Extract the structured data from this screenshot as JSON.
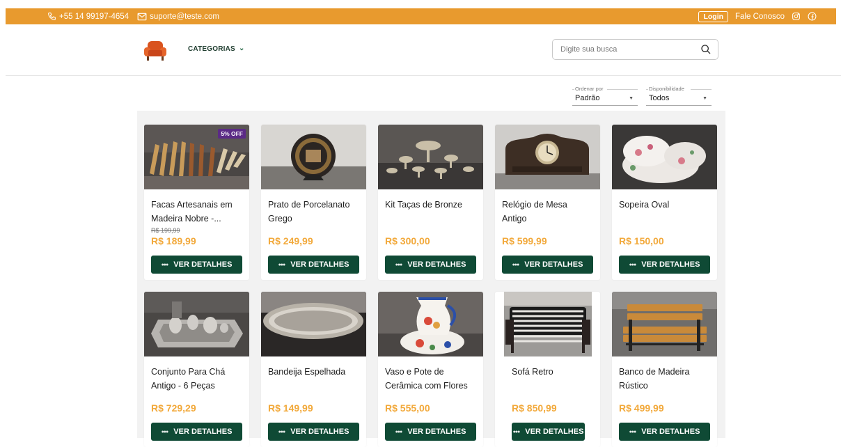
{
  "topbar": {
    "phone": "+55 14 99197-4654",
    "email": "suporte@teste.com",
    "login_label": "Login",
    "contact_label": "Fale Conosco",
    "bg_color": "#e89a2e"
  },
  "header": {
    "categories_label": "CATEGORIAS",
    "search": {
      "placeholder": "Digite sua busca",
      "value": ""
    }
  },
  "filters": {
    "sort": {
      "label": "Ordenar por",
      "value": "Padrão"
    },
    "availability": {
      "label": "Disponibilidade",
      "value": "Todos"
    }
  },
  "colors": {
    "accent": "#0f4a35",
    "price": "#f2a93b",
    "badge": "#5b2a86"
  },
  "products": [
    {
      "title": "Facas Artesanais em Madeira Nobre -...",
      "old_price": "R$ 199,99",
      "price": "R$ 189,99",
      "badge": "5% OFF",
      "button": "VER DETALHES"
    },
    {
      "title": "Prato de Porcelanato Grego",
      "price": "R$ 249,99",
      "button": "VER DETALHES"
    },
    {
      "title": "Kit Taças de Bronze",
      "price": "R$ 300,00",
      "button": "VER DETALHES"
    },
    {
      "title": "Relógio de Mesa Antigo",
      "price": "R$ 599,99",
      "button": "VER DETALHES"
    },
    {
      "title": "Sopeira Oval",
      "price": "R$ 150,00",
      "button": "VER DETALHES"
    },
    {
      "title": "Conjunto Para Chá Antigo - 6 Peças",
      "price": "R$ 729,29",
      "button": "VER DETALHES"
    },
    {
      "title": "Bandeija Espelhada",
      "price": "R$ 149,99",
      "button": "VER DETALHES"
    },
    {
      "title": "Vaso e Pote de Cerâmica com Flores",
      "price": "R$ 555,00",
      "button": "VER DETALHES"
    },
    {
      "title": "Sofá Retro",
      "price": "R$ 850,99",
      "button": "VER DETALHES"
    },
    {
      "title": "Banco de Madeira Rústico",
      "price": "R$ 499,99",
      "button": "VER DETALHES"
    }
  ]
}
